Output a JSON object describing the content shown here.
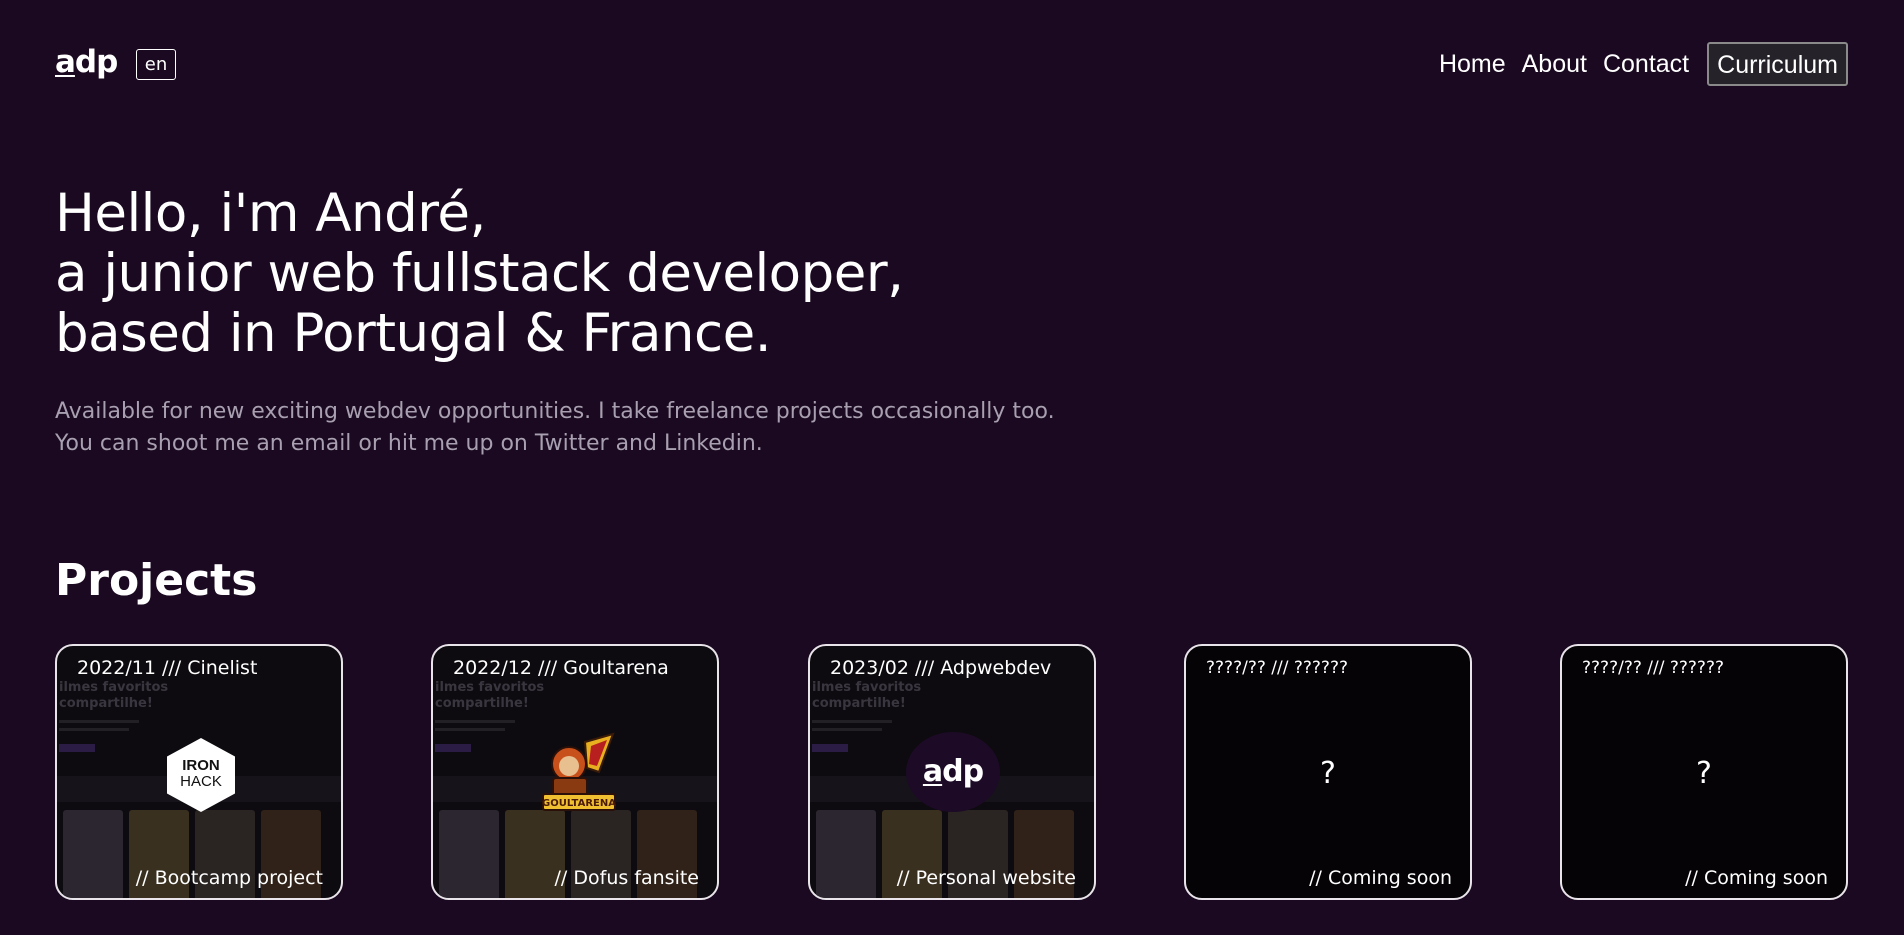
{
  "header": {
    "logo_first": "a",
    "logo_rest": "dp",
    "language": "en",
    "nav": [
      "Home",
      "About",
      "Contact"
    ],
    "cv_label": "Curriculum"
  },
  "hero": {
    "lines": [
      "Hello, i'm André,",
      "a junior web fullstack developer,",
      "based in Portugal & France."
    ],
    "subtitle": [
      "Available for new exciting webdev opportunities. I take freelance projects occasionally too.",
      "You can shoot me an email or hit me up on Twitter and Linkedin."
    ]
  },
  "projects": {
    "title": "Projects",
    "cards": [
      {
        "head": "2022/11 /// Cinelist",
        "foot": "// Bootcamp project",
        "badge_l1": "IRON",
        "badge_l2": "HACK",
        "ghost": "ilmes favoritos\ncompartilhe!"
      },
      {
        "head": "2022/12 /// Goultarena",
        "foot": "// Dofus fansite",
        "badge_text": "GOULTARENA",
        "ghost": "ilmes favoritos\ncompartilhe!"
      },
      {
        "head": "2023/02 /// Adpwebdev",
        "foot": "// Personal website",
        "badge_first": "a",
        "badge_rest": "dp",
        "ghost": "ilmes favoritos\ncompartilhe!"
      },
      {
        "head": "????/?? /// ??????",
        "foot": "// Coming soon",
        "mark": "?"
      },
      {
        "head": "????/?? /// ??????",
        "foot": "// Coming soon",
        "mark": "?"
      }
    ]
  },
  "colors": {
    "background": "#1a0920",
    "subtitle": "#a89fb0",
    "card_border": "#e8e4ea"
  }
}
